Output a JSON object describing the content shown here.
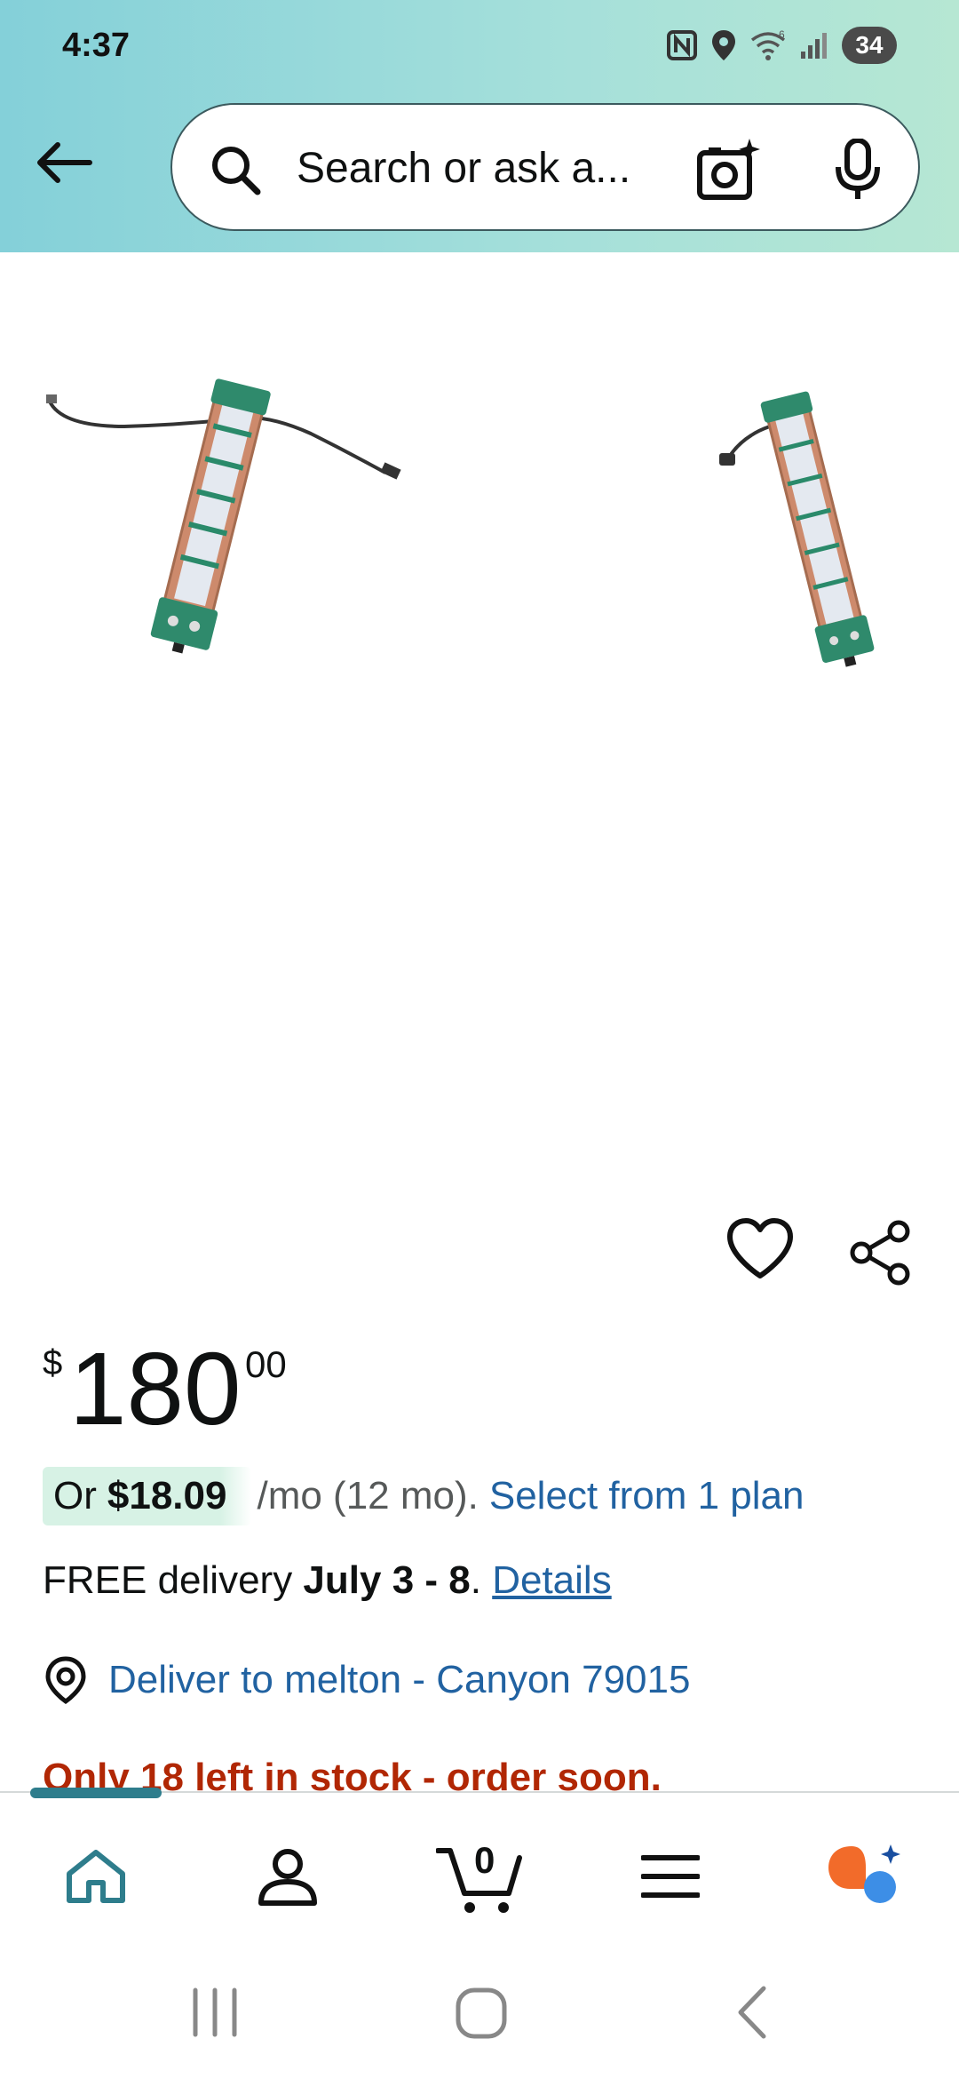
{
  "status_bar": {
    "time": "4:37",
    "battery": "34",
    "icons": [
      "nfc-icon",
      "location-icon",
      "wifi-icon",
      "signal-icon",
      "battery-icon"
    ]
  },
  "search": {
    "placeholder": "Search or ask a..."
  },
  "product": {
    "price_symbol": "$",
    "price_whole": "180",
    "price_fraction": "00",
    "monthly_prefix": "Or",
    "monthly_amount": "$18.09",
    "monthly_suffix": "/mo (12 mo).",
    "monthly_link": "Select from 1 plan",
    "delivery_prefix": "FREE delivery",
    "delivery_dates": "July 3 - 8",
    "delivery_period": ".",
    "delivery_link": "Details",
    "deliver_to": "Deliver to melton - Canyon 79015",
    "stock": "Only 18 left in stock - order soon."
  },
  "cart": {
    "count": "0"
  },
  "bottom_nav": [
    "home",
    "account",
    "cart",
    "menu",
    "rufus"
  ],
  "colors": {
    "link": "#2162a1",
    "stock_red": "#b12704",
    "nav_accent": "#2e7d8c",
    "header_gradient_start": "#84d0d9",
    "header_gradient_end": "#b6e7d3"
  }
}
